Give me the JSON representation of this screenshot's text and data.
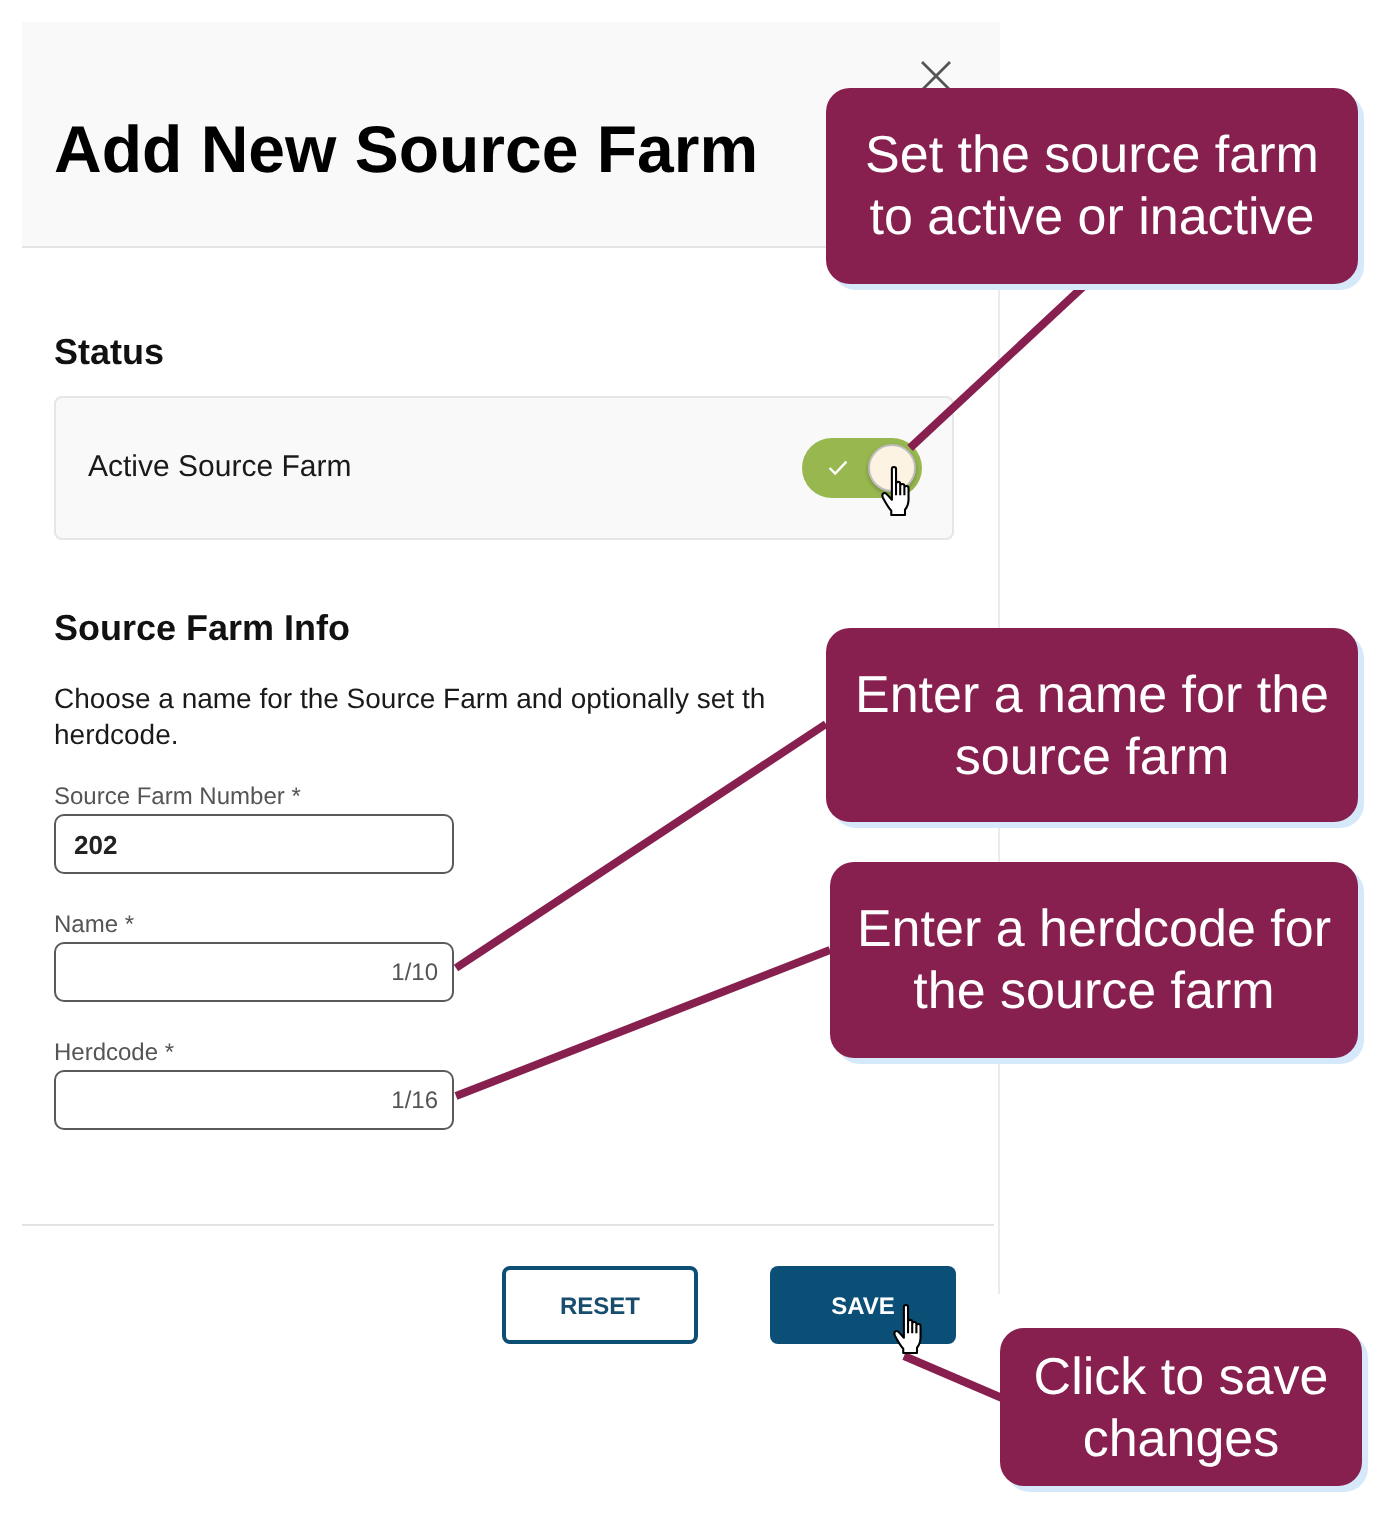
{
  "dialog": {
    "title": "Add New Source Farm"
  },
  "status": {
    "heading": "Status",
    "toggle": {
      "label": "Active Source Farm",
      "on": true
    }
  },
  "info": {
    "heading": "Source Farm Info",
    "description": "Choose a name for the Source Farm and optionally set th herdcode.",
    "fields": [
      {
        "label": "Source Farm Number *",
        "value": "202"
      },
      {
        "label": "Name *",
        "counter": "1/10"
      },
      {
        "label": "Herdcode *",
        "counter": "1/16"
      }
    ]
  },
  "buttons": [
    {
      "label": "RESET",
      "kind": "outline"
    },
    {
      "label": "SAVE",
      "kind": "primary"
    }
  ],
  "callouts": [
    {
      "text": "Set the source farm to active or inactive"
    },
    {
      "text": "Enter a name for the source farm"
    },
    {
      "text": "Enter a herdcode for the source farm"
    },
    {
      "text": "Click to save changes"
    }
  ]
}
